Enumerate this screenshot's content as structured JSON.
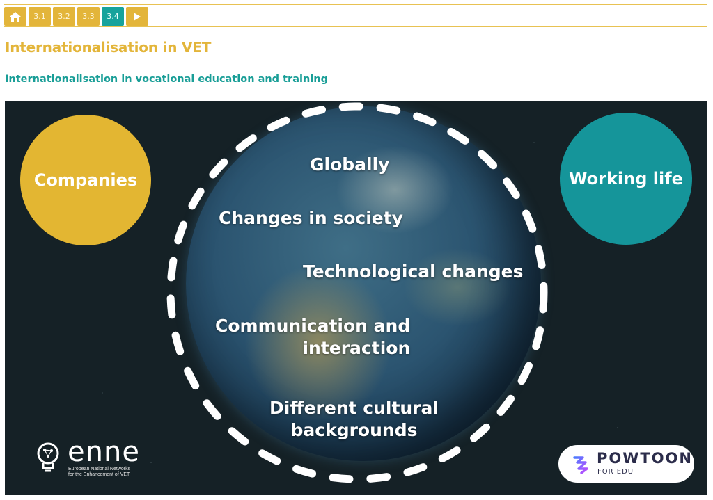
{
  "nav": {
    "home_icon": "home-icon",
    "items": [
      {
        "label": "3.1",
        "active": false
      },
      {
        "label": "3.2",
        "active": false
      },
      {
        "label": "3.3",
        "active": false
      },
      {
        "label": "3.4",
        "active": true
      }
    ],
    "next_icon": "play-icon"
  },
  "page": {
    "title": "Internationalisation in VET",
    "subtitle": "Internationalisation in vocational education and training"
  },
  "video": {
    "left_circle": "Companies",
    "right_circle": "Working life",
    "globe_items": {
      "globally": "Globally",
      "society": "Changes in society",
      "tech": "Technological changes",
      "comm_line1": "Communication and",
      "comm_line2": "interaction",
      "cultural_line1": "Different cultural",
      "cultural_line2": "backgrounds"
    },
    "enne_logo": {
      "word": "enne",
      "tagline_line1": "European National Networks",
      "tagline_line2": "for the Enhancement of VET"
    },
    "powtoon_logo": {
      "name": "POWTOON",
      "sub": "FOR EDU"
    }
  },
  "colors": {
    "gold": "#e3b53a",
    "teal": "#17a39c",
    "space": "#152126"
  }
}
